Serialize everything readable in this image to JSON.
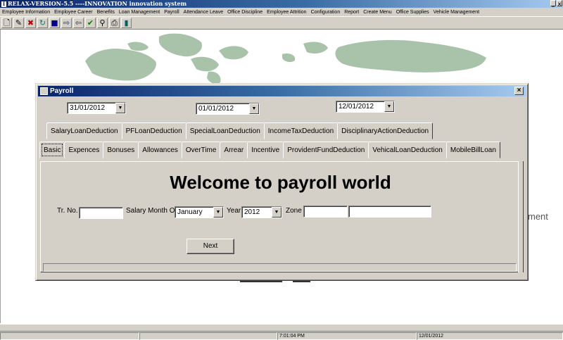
{
  "app": {
    "title": "RELAX-VERSION-5.5 ----INNOVATION innovation system"
  },
  "menu": [
    "Employee Information",
    "Employee Career",
    "Benefits",
    "Loan Management",
    "Payroll",
    "Attendance Leave",
    "Office Discipline",
    "Employee Attrition",
    "Configuration",
    "Report",
    "Create Menu",
    "Office Supplies",
    "Vehicle Management"
  ],
  "toolbar": [
    "new-document-icon",
    "edit-icon",
    "delete-icon",
    "refresh-icon",
    "save-icon",
    "forward-icon",
    "back-icon",
    "check-icon",
    "user-search-icon",
    "print-icon",
    "exit-door-icon"
  ],
  "background": {
    "partial_text": "ment"
  },
  "dialog": {
    "title": "Payroll",
    "dates": {
      "from": "31/01/2012",
      "to": "01/01/2012",
      "current": "12/01/2012"
    },
    "tabs_row1": [
      "SalaryLoanDeduction",
      "PFLoanDeduction",
      "SpecialLoanDeduction",
      "IncomeTaxDeduction",
      "DisciplinaryActionDeduction"
    ],
    "tabs_row2": [
      "Basic",
      "Expences",
      "Bonuses",
      "Allowances",
      "OverTime",
      "Arrear",
      "Incentive",
      "ProvidentFundDeduction",
      "VehicalLoanDeduction",
      "MobileBillLoan"
    ],
    "active_tab": "Basic",
    "heading": "Welcome to payroll world",
    "form": {
      "trno_label": "Tr. No.",
      "trno_value": "",
      "salary_month_label": "Salary Month Of",
      "salary_month_value": "January",
      "year_label": "Year",
      "year_value": "2012",
      "zone_label": "Zone",
      "zone_code": "",
      "zone_name": ""
    },
    "next_button": "Next"
  },
  "status": {
    "time": "7:01:04 PM",
    "date": "12/01/2012"
  },
  "colors": {
    "titlebar_start": "#0a246a",
    "titlebar_end": "#a6caf0",
    "face": "#d4d0c8",
    "map": "#a9c2aa"
  }
}
